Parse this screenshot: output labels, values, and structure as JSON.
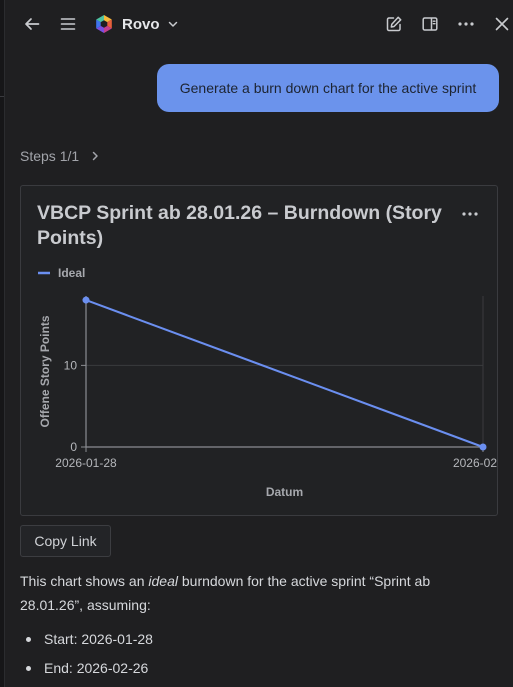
{
  "topbar": {
    "back_icon": "arrow-left-icon",
    "menu_icon": "hamburger-icon",
    "brand_name": "Rovo",
    "brand_dropdown_icon": "chevron-down-icon",
    "edit_icon": "edit-icon",
    "panel_icon": "sidebar-panel-icon",
    "more_icon": "more-horizontal-icon",
    "close_icon": "close-icon"
  },
  "conversation": {
    "user_message": "Generate a burn down chart for the active sprint",
    "steps_label": "Steps 1/1"
  },
  "chart_card": {
    "title": "VBCP Sprint ab 28.01.26 – Burndown (Story Points)",
    "more_icon": "more-horizontal-icon"
  },
  "chart_data": {
    "type": "line",
    "title": "VBCP Sprint ab 28.01.26 – Burndown (Story Points)",
    "xlabel": "Datum",
    "ylabel": "Offene Story Points",
    "x_ticks": [
      "2026-01-28",
      "2026-02"
    ],
    "y_ticks": [
      0,
      10
    ],
    "ylim": [
      0,
      18.5
    ],
    "grid": true,
    "legend": "top-left",
    "series": [
      {
        "name": "Ideal",
        "color": "#6b8ff0",
        "points": [
          {
            "x": "2026-01-28",
            "y": 18
          },
          {
            "x": "2026-02-26",
            "y": 0
          }
        ]
      }
    ],
    "colors": {
      "axis": "#8b8d92",
      "grid": "#3a3b3e",
      "text": "#b5b7bb",
      "label": "#a6a8ad"
    }
  },
  "actions": {
    "copy_link_label": "Copy Link"
  },
  "answer": {
    "intro_before": "This chart shows an ",
    "intro_emphasis": "ideal",
    "intro_after": " burndown for the active sprint “Sprint ab 28.01.26”, assuming:",
    "bullets": [
      "Start: 2026-01-28",
      "End: 2026-02-26"
    ]
  }
}
